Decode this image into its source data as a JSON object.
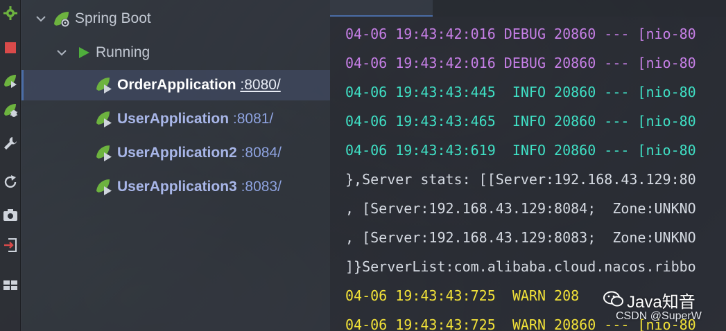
{
  "colors": {
    "debug": "#c67fe6",
    "info": "#3fe0c5",
    "warn": "#f2e238",
    "plain": "#d6dbe3",
    "spring_green": "#6db33f",
    "selection_accent": "#4a6da7"
  },
  "toolbar": {
    "buttons": [
      {
        "icon": "spring-gear-icon"
      },
      {
        "icon": "stop-icon"
      },
      {
        "icon": "run-spring-icon"
      },
      {
        "icon": "debug-spring-icon"
      },
      {
        "icon": "wrench-icon"
      },
      {
        "icon": "refresh-icon"
      },
      {
        "icon": "camera-icon"
      },
      {
        "icon": "login-icon"
      },
      {
        "icon": "layout-icon"
      }
    ]
  },
  "tree": {
    "root_label": "Spring Boot",
    "group_label": "Running",
    "apps": [
      {
        "name": "OrderApplication",
        "port": ":8080/",
        "selected": true
      },
      {
        "name": "UserApplication",
        "port": ":8081/",
        "selected": false
      },
      {
        "name": "UserApplication2",
        "port": ":8084/",
        "selected": false
      },
      {
        "name": "UserApplication3",
        "port": ":8083/",
        "selected": false
      }
    ]
  },
  "console": {
    "lines": [
      {
        "text": "04-06 19:43:42:016 DEBUG 20860 --- [nio-80",
        "level": "debug"
      },
      {
        "text": "04-06 19:43:42:016 DEBUG 20860 --- [nio-80",
        "level": "debug"
      },
      {
        "text": "04-06 19:43:43:445  INFO 20860 --- [nio-80",
        "level": "info"
      },
      {
        "text": "04-06 19:43:43:465  INFO 20860 --- [nio-80",
        "level": "info"
      },
      {
        "text": "04-06 19:43:43:619  INFO 20860 --- [nio-80",
        "level": "info"
      },
      {
        "text": "},Server stats: [[Server:192.168.43.129:80",
        "level": "plain"
      },
      {
        "text": ", [Server:192.168.43.129:8084;  Zone:UNKNO",
        "level": "plain"
      },
      {
        "text": ", [Server:192.168.43.129:8083;  Zone:UNKNO",
        "level": "plain"
      },
      {
        "text": "]}ServerList:com.alibaba.cloud.nacos.ribbo",
        "level": "plain"
      },
      {
        "text": "04-06 19:43:43:725  WARN 208",
        "level": "warn"
      },
      {
        "text": "04-06 19:43:43:725  WARN 20860 --- [nio-80",
        "level": "warn"
      }
    ]
  },
  "watermark": {
    "title": "Java知音",
    "subtitle": "CSDN @SuperW"
  }
}
